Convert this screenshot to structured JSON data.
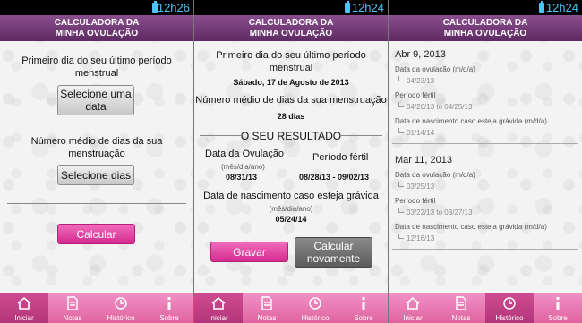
{
  "status": {
    "time1": "12h26",
    "time2": "12h24",
    "time3": "12h24"
  },
  "app": {
    "title_line1": "CALCULADORA DA",
    "title_line2": "MINHA OVULAÇÃO"
  },
  "screen1": {
    "first_day_label": "Primeiro dia do seu último período menstrual",
    "select_date_btn": "Selecione uma data",
    "avg_days_label": "Número médio de dias da sua menstruação",
    "select_days_btn": "Selecione dias",
    "calculate_btn": "Calcular"
  },
  "screen2": {
    "first_day_label": "Primeiro dia do seu último período menstrual",
    "selected_date": "Sábado, 17 de Agosto de 2013",
    "avg_days_label": "Número médio de dias da sua menstruação",
    "avg_days_value": "28 dias",
    "result_header": "O SEU RESULTADO",
    "ovulation_label": "Data da Ovulação",
    "ovulation_format": "(mês/dia/ano)",
    "ovulation_value": "08/31/13",
    "fertile_label": "Período fértil",
    "fertile_value": "08/28/13 - 09/02/13",
    "birth_label": "Data de nascimento caso esteja grávida",
    "birth_format": "(mês/dia/ano)",
    "birth_value": "05/24/14",
    "save_btn": "Gravar",
    "recalc_btn": "Calcular novamente"
  },
  "screen3": {
    "entries": [
      {
        "date": "Abr 9, 2013",
        "ovulation_label": "Data da ovulação (m/d/a)",
        "ovulation_value": "04/23/13",
        "fertile_label": "Período fértil",
        "fertile_value": "04/20/13 to 04/25/13",
        "birth_label": "Data de nascimento caso esteja grávida (m/d/a)",
        "birth_value": "01/14/14"
      },
      {
        "date": "Mar 11, 2013",
        "ovulation_label": "Data da ovulação (m/d/a)",
        "ovulation_value": "03/25/13",
        "fertile_label": "Período fértil",
        "fertile_value": "03/22/13 to 03/27/13",
        "birth_label": "Data de nascimento caso esteja grávida (m/d/a)",
        "birth_value": "12/16/13"
      }
    ]
  },
  "nav": {
    "home": "Iniciar",
    "notes": "Notas",
    "history": "Histórico",
    "about": "Sobre"
  },
  "colors": {
    "title": "#6d3671",
    "pink": "#e0489f",
    "nav": "#e773b2",
    "status_text": "#4fc3f7"
  }
}
